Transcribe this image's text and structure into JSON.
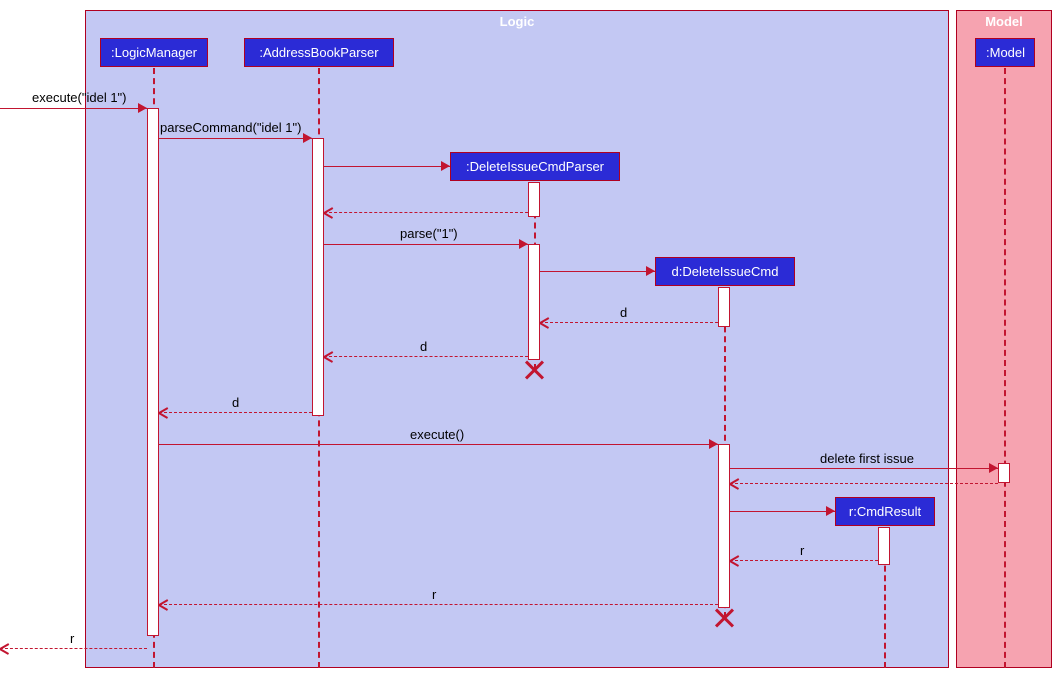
{
  "frames": {
    "logic": "Logic",
    "model": "Model"
  },
  "participants": {
    "logicManager": ":LogicManager",
    "addressBookParser": ":AddressBookParser",
    "deleteIssueCmdParser": ":DeleteIssueCmdParser",
    "deleteIssueCmd": "d:DeleteIssueCmd",
    "cmdResult": "r:CmdResult",
    "model": ":Model"
  },
  "messages": {
    "execute_idel1": "execute(\"idel 1\")",
    "parseCommand": "parseCommand(\"idel 1\")",
    "parse1": "parse(\"1\")",
    "d": "d",
    "execute": "execute()",
    "deleteFirstIssue": "delete first issue",
    "r": "r"
  },
  "chart_data": {
    "type": "sequence-diagram",
    "frames": [
      {
        "name": "Logic",
        "participants": [
          ":LogicManager",
          ":AddressBookParser",
          ":DeleteIssueCmdParser",
          "d:DeleteIssueCmd",
          "r:CmdResult"
        ]
      },
      {
        "name": "Model",
        "participants": [
          ":Model"
        ]
      }
    ],
    "messages": [
      {
        "from": "external",
        "to": ":LogicManager",
        "label": "execute(\"idel 1\")",
        "type": "sync"
      },
      {
        "from": ":LogicManager",
        "to": ":AddressBookParser",
        "label": "parseCommand(\"idel 1\")",
        "type": "sync"
      },
      {
        "from": ":AddressBookParser",
        "to": ":DeleteIssueCmdParser",
        "label": "",
        "type": "create"
      },
      {
        "from": ":DeleteIssueCmdParser",
        "to": ":AddressBookParser",
        "label": "",
        "type": "return"
      },
      {
        "from": ":AddressBookParser",
        "to": ":DeleteIssueCmdParser",
        "label": "parse(\"1\")",
        "type": "sync"
      },
      {
        "from": ":DeleteIssueCmdParser",
        "to": "d:DeleteIssueCmd",
        "label": "",
        "type": "create"
      },
      {
        "from": "d:DeleteIssueCmd",
        "to": ":DeleteIssueCmdParser",
        "label": "d",
        "type": "return"
      },
      {
        "from": ":DeleteIssueCmdParser",
        "to": ":AddressBookParser",
        "label": "d",
        "type": "return",
        "destroy": ":DeleteIssueCmdParser"
      },
      {
        "from": ":AddressBookParser",
        "to": ":LogicManager",
        "label": "d",
        "type": "return"
      },
      {
        "from": ":LogicManager",
        "to": "d:DeleteIssueCmd",
        "label": "execute()",
        "type": "sync"
      },
      {
        "from": "d:DeleteIssueCmd",
        "to": ":Model",
        "label": "delete first issue",
        "type": "sync"
      },
      {
        "from": ":Model",
        "to": "d:DeleteIssueCmd",
        "label": "",
        "type": "return"
      },
      {
        "from": "d:DeleteIssueCmd",
        "to": "r:CmdResult",
        "label": "",
        "type": "create"
      },
      {
        "from": "r:CmdResult",
        "to": "d:DeleteIssueCmd",
        "label": "r",
        "type": "return"
      },
      {
        "from": "d:DeleteIssueCmd",
        "to": ":LogicManager",
        "label": "r",
        "type": "return",
        "destroy": "d:DeleteIssueCmd"
      },
      {
        "from": ":LogicManager",
        "to": "external",
        "label": "r",
        "type": "return"
      }
    ]
  }
}
